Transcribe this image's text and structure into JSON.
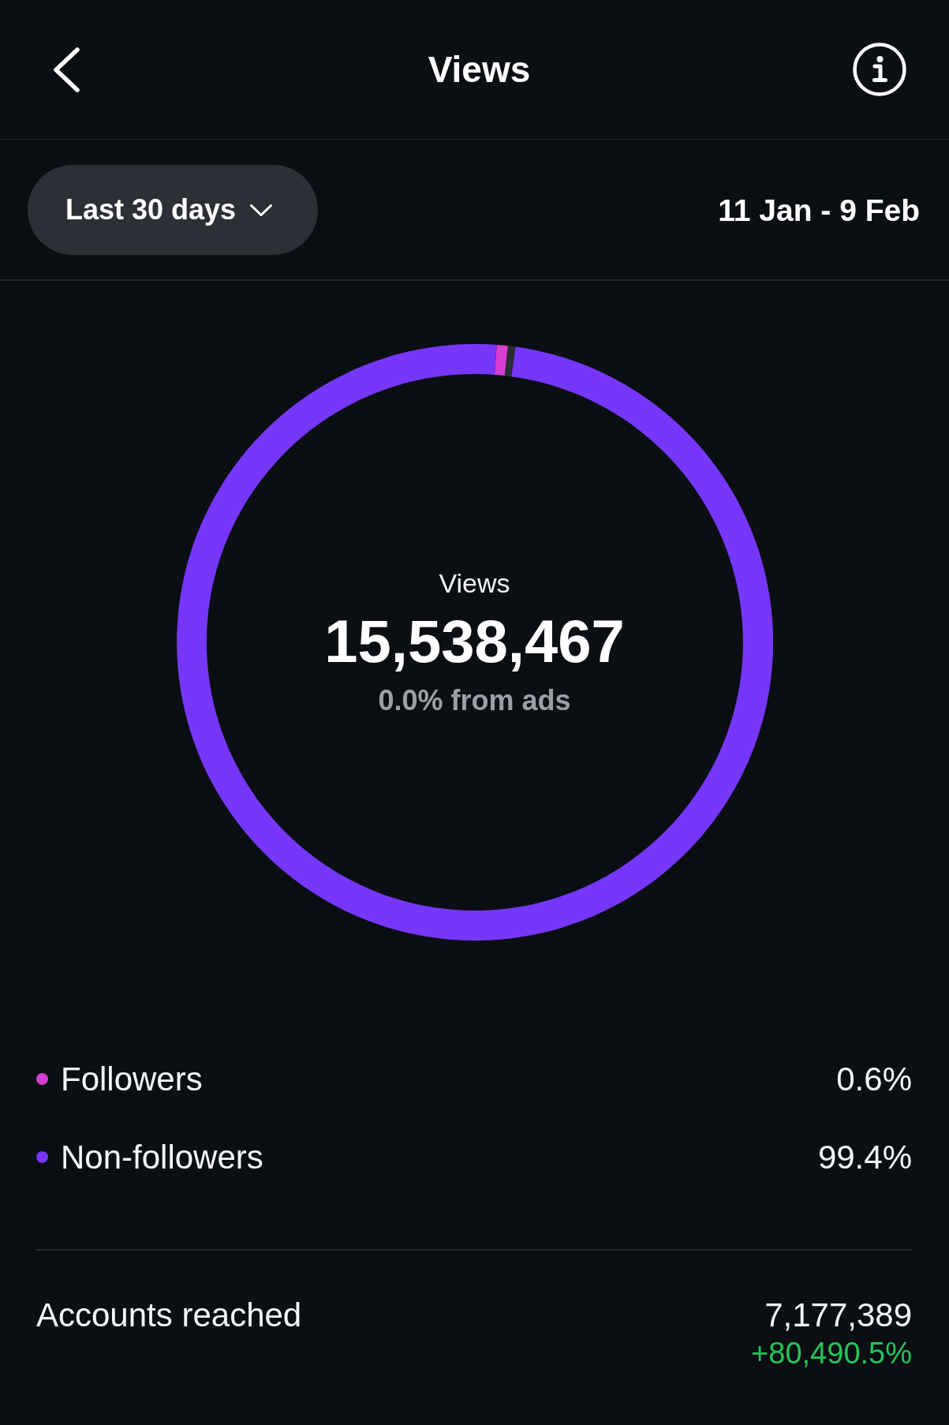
{
  "header": {
    "title": "Views"
  },
  "filter": {
    "period": "Last 30 days",
    "date_range": "11 Jan - 9 Feb"
  },
  "views_chart": {
    "center_label": "Views",
    "total": "15,538,467",
    "ads_share": "0.0% from ads",
    "chart_data": {
      "type": "donut",
      "categories": [
        "Followers",
        "Non-followers"
      ],
      "values": [
        0.6,
        99.4
      ]
    }
  },
  "legend": [
    {
      "value": "0.6%",
      "color": "#d63dd0"
    },
    {
      "value": "99.4%",
      "color": "#7637fa"
    }
  ],
  "metrics": [
    {
      "label": "Accounts reached",
      "value": "7,177,389",
      "change": "+80,490.5%",
      "increase": true
    }
  ]
}
